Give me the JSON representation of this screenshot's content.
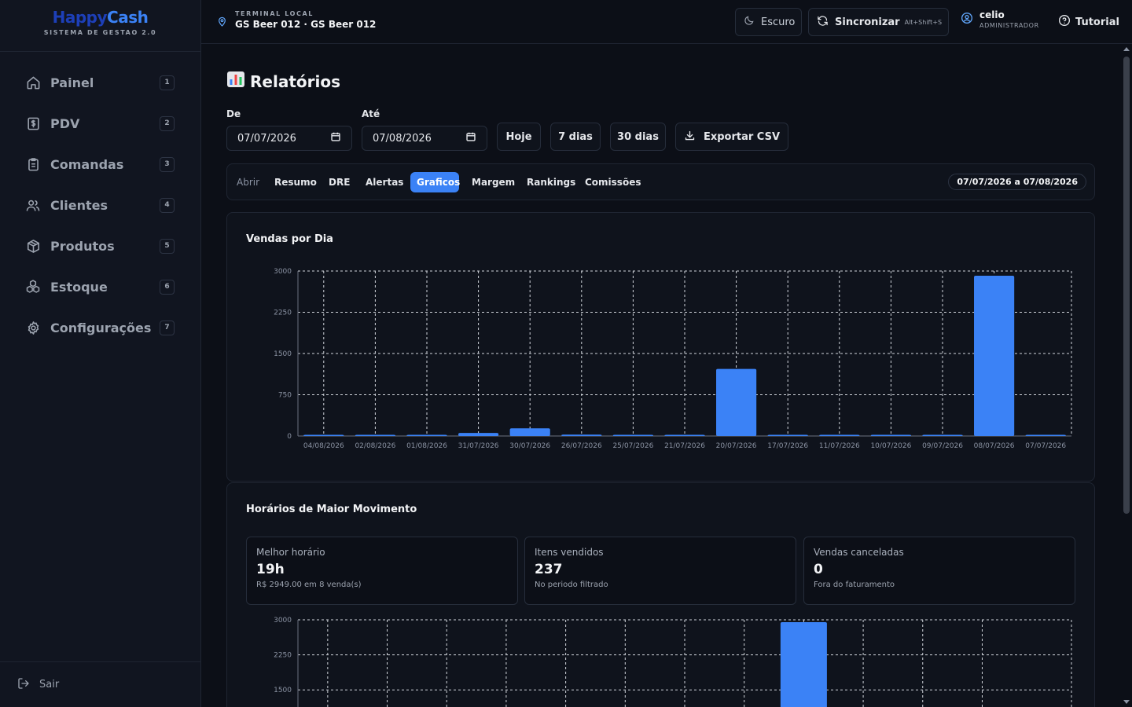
{
  "brand": {
    "name_part1": "Happy",
    "name_part2": "Cash",
    "subtitle": "SISTEMA DE GESTAO 2.0"
  },
  "sidebar": {
    "items": [
      {
        "label": "Painel",
        "shortcut": "1",
        "icon": "home-icon"
      },
      {
        "label": "PDV",
        "shortcut": "2",
        "icon": "dollar-icon"
      },
      {
        "label": "Comandas",
        "shortcut": "3",
        "icon": "clipboard-icon"
      },
      {
        "label": "Clientes",
        "shortcut": "4",
        "icon": "users-icon"
      },
      {
        "label": "Produtos",
        "shortcut": "5",
        "icon": "box-icon"
      },
      {
        "label": "Estoque",
        "shortcut": "6",
        "icon": "boxes-icon"
      },
      {
        "label": "Configurações",
        "shortcut": "7",
        "icon": "gear-icon"
      }
    ],
    "logout_label": "Sair"
  },
  "header": {
    "terminal_label": "TERMINAL LOCAL",
    "terminal_name": "GS Beer 012 · GS Beer 012",
    "theme_label": "Escuro",
    "sync_label": "Sincronizar",
    "sync_shortcut": "Alt+Shift+S",
    "user_name": "celio",
    "user_role": "ADMINISTRADOR",
    "tutorial_label": "Tutorial"
  },
  "page": {
    "title": "Relatórios",
    "from_label": "De",
    "from_value": "07/07/2026",
    "to_label": "Até",
    "to_value": "07/08/2026",
    "quick_today": "Hoje",
    "quick_7": "7 dias",
    "quick_30": "30 dias",
    "export_label": "Exportar CSV"
  },
  "tabs": [
    {
      "label": "Abrir"
    },
    {
      "label": "Resumo"
    },
    {
      "label": "DRE"
    },
    {
      "label": "Alertas"
    },
    {
      "label": "Graficos"
    },
    {
      "label": "Margem"
    },
    {
      "label": "Rankings"
    },
    {
      "label": "Comissões"
    }
  ],
  "active_tab": "Graficos",
  "range_badge": "07/07/2026 a 07/08/2026",
  "sales_card": {
    "title": "Vendas por Dia"
  },
  "peak_card": {
    "title": "Horários de Maior Movimento",
    "stats": [
      {
        "label": "Melhor horário",
        "value": "19h",
        "sub": "R$ 2949.00 em 8 venda(s)"
      },
      {
        "label": "Itens vendidos",
        "value": "237",
        "sub": "No periodo filtrado"
      },
      {
        "label": "Vendas canceladas",
        "value": "0",
        "sub": "Fora do faturamento"
      }
    ]
  },
  "colors": {
    "accent": "#3b82f6",
    "background": "#0c0f17",
    "panel": "#0f131c"
  },
  "chart_data": [
    {
      "type": "bar",
      "title": "Vendas por Dia",
      "categories": [
        "04/08/2026",
        "02/08/2026",
        "01/08/2026",
        "31/07/2026",
        "30/07/2026",
        "26/07/2026",
        "25/07/2026",
        "21/07/2026",
        "20/07/2026",
        "17/07/2026",
        "11/07/2026",
        "10/07/2026",
        "09/07/2026",
        "08/07/2026",
        "07/07/2026"
      ],
      "values": [
        20,
        5,
        5,
        55,
        140,
        25,
        5,
        8,
        1220,
        12,
        10,
        5,
        12,
        2915,
        8
      ],
      "yticks": [
        0,
        750,
        1500,
        2250,
        3000
      ],
      "ylim": [
        0,
        3000
      ],
      "grid": true,
      "color": "#3b82f6"
    },
    {
      "type": "bar",
      "title": "Horários de Maior Movimento",
      "categories": [
        "",
        "",
        "",
        "",
        "",
        "",
        "",
        "",
        "",
        "",
        "",
        "",
        ""
      ],
      "values": [
        0,
        0,
        0,
        0,
        0,
        0,
        0,
        0,
        2949,
        0,
        0,
        0,
        0
      ],
      "yticks": [
        1500,
        2250,
        3000
      ],
      "ylim": [
        0,
        3000
      ],
      "grid": true,
      "color": "#3b82f6"
    }
  ]
}
